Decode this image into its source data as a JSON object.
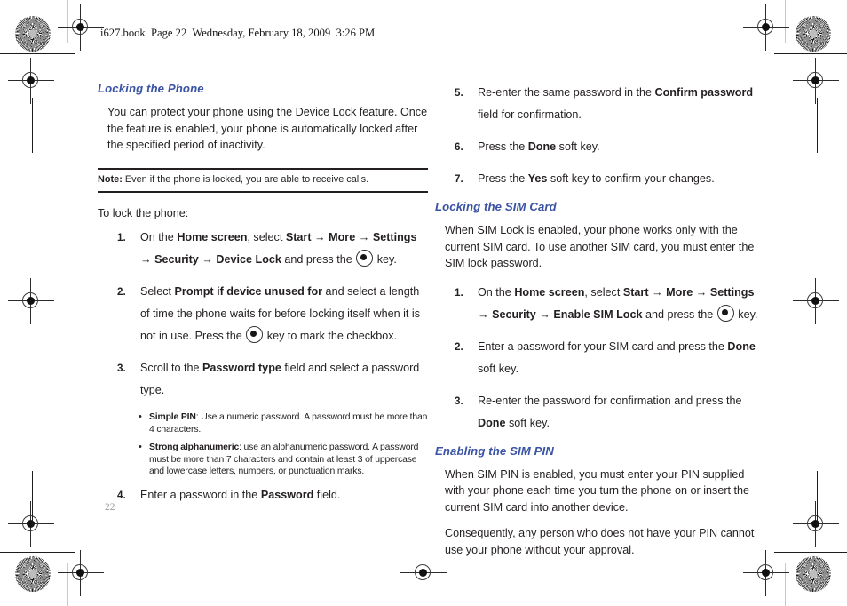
{
  "header": {
    "line": "i627.book  Page 22  Wednesday, February 18, 2009  3:26 PM"
  },
  "page_number": "22",
  "colors": {
    "heading_blue": "#3a53a4",
    "body_text": "#231f20",
    "page_number_gray": "#9a9a9a"
  },
  "icons": {
    "ok_key": "ok-key-icon",
    "arrow": "→",
    "bullet": "•"
  },
  "left_column": {
    "heading": "Locking the Phone",
    "intro": "You can protect your phone using the Device Lock feature. Once the feature is enabled, your phone is automatically locked after the specified period of inactivity.",
    "note": {
      "label": "Note:",
      "text": " Even if the phone is locked, you are able to receive calls."
    },
    "lead": "To lock the phone:",
    "steps": [
      {
        "num": "1.",
        "parts": [
          {
            "t": "On the ",
            "b": false
          },
          {
            "t": "Home screen",
            "b": true
          },
          {
            "t": ", select ",
            "b": false
          },
          {
            "t": "Start",
            "b": true
          },
          {
            "t": " → ",
            "b": true
          },
          {
            "t": "More",
            "b": true
          },
          {
            "t": " → ",
            "b": true
          },
          {
            "t": "Settings",
            "b": true
          },
          {
            "t": " → ",
            "b": true
          },
          {
            "t": "Security",
            "b": true
          },
          {
            "t": " → ",
            "b": true
          },
          {
            "t": "Device Lock",
            "b": true
          },
          {
            "t": " and press the ",
            "b": false
          },
          {
            "t": "[key]",
            "b": false
          },
          {
            "t": " key.",
            "b": false
          }
        ]
      },
      {
        "num": "2.",
        "parts": [
          {
            "t": "Select ",
            "b": false
          },
          {
            "t": "Prompt if device unused for",
            "b": true
          },
          {
            "t": " and select a length of time the phone waits for before locking itself when it is not in use. Press the ",
            "b": false
          },
          {
            "t": "[key]",
            "b": false
          },
          {
            "t": " key to mark the checkbox.",
            "b": false
          }
        ]
      },
      {
        "num": "3.",
        "parts": [
          {
            "t": "Scroll to the ",
            "b": false
          },
          {
            "t": "Password type",
            "b": true
          },
          {
            "t": " field and select a password type.",
            "b": false
          }
        ]
      },
      {
        "num": "4.",
        "parts": [
          {
            "t": "Enter a password in the ",
            "b": false
          },
          {
            "t": "Password",
            "b": true
          },
          {
            "t": " field.",
            "b": false
          }
        ]
      }
    ],
    "bullets": [
      {
        "label": "Simple PIN",
        "text": ": Use a numeric password. A password must be more than 4 characters."
      },
      {
        "label": "Strong alphanumeric",
        "text": ": use an alphanumeric password. A password must be more than 7 characters and contain at least 3 of uppercase and lowercase letters, numbers, or punctuation marks."
      }
    ]
  },
  "right_column": {
    "continued_steps": [
      {
        "num": "5.",
        "parts": [
          {
            "t": "Re-enter the same password in the ",
            "b": false
          },
          {
            "t": "Confirm password",
            "b": true
          },
          {
            "t": " field for confirmation.",
            "b": false
          }
        ]
      },
      {
        "num": "6.",
        "parts": [
          {
            "t": "Press the ",
            "b": false
          },
          {
            "t": "Done",
            "b": true
          },
          {
            "t": " soft key.",
            "b": false
          }
        ]
      },
      {
        "num": "7.",
        "parts": [
          {
            "t": "Press the ",
            "b": false
          },
          {
            "t": "Yes",
            "b": true
          },
          {
            "t": " soft key to confirm your changes.",
            "b": false
          }
        ]
      }
    ],
    "sim_card": {
      "heading": "Locking the SIM Card",
      "intro": "When SIM Lock is enabled, your phone works only with the current SIM card. To use another SIM card, you must enter the SIM lock password.",
      "steps": [
        {
          "num": "1.",
          "parts": [
            {
              "t": "On the ",
              "b": false
            },
            {
              "t": "Home screen",
              "b": true
            },
            {
              "t": ", select ",
              "b": false
            },
            {
              "t": "Start",
              "b": true
            },
            {
              "t": " → ",
              "b": true
            },
            {
              "t": "More",
              "b": true
            },
            {
              "t": " → ",
              "b": true
            },
            {
              "t": "Settings",
              "b": true
            },
            {
              "t": " → ",
              "b": true
            },
            {
              "t": "Security",
              "b": true
            },
            {
              "t": " → ",
              "b": true
            },
            {
              "t": "Enable SIM Lock",
              "b": true
            },
            {
              "t": " and press the ",
              "b": false
            },
            {
              "t": "[key]",
              "b": false
            },
            {
              "t": " key.",
              "b": false
            }
          ]
        },
        {
          "num": "2.",
          "parts": [
            {
              "t": "Enter a password for your SIM card and press the ",
              "b": false
            },
            {
              "t": "Done",
              "b": true
            },
            {
              "t": " soft key.",
              "b": false
            }
          ]
        },
        {
          "num": "3.",
          "parts": [
            {
              "t": "Re-enter the password for confirmation and press the ",
              "b": false
            },
            {
              "t": "Done",
              "b": true
            },
            {
              "t": " soft key.",
              "b": false
            }
          ]
        }
      ]
    },
    "sim_pin": {
      "heading": "Enabling the SIM PIN",
      "paragraphs": [
        "When SIM PIN is enabled, you must enter your PIN supplied with your phone each time you turn the phone on or insert the current SIM card into another device.",
        "Consequently, any person who does not have your PIN cannot use your phone without your approval."
      ]
    }
  }
}
